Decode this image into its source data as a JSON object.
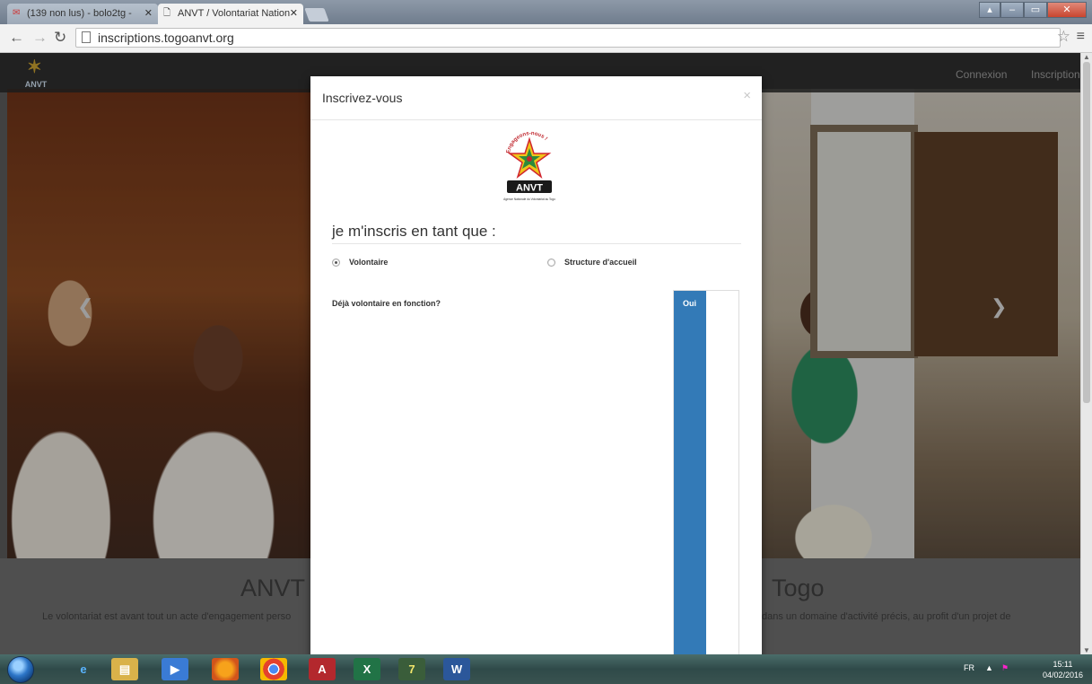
{
  "browser": {
    "tabs": [
      {
        "label": "(139 non lus) - bolo2tg - ",
        "icon": "gmail-icon",
        "active": false
      },
      {
        "label": "ANVT / Volontariat Nation",
        "icon": "page-icon",
        "active": true
      }
    ],
    "address": "inscriptions.togoanvt.org"
  },
  "site": {
    "logo_text": "ANVT",
    "nav": {
      "login": "Connexion",
      "register": "Inscription"
    },
    "caption_title_left": "ANVT",
    "caption_title_right": "Togo",
    "caption_text_left": "Le volontariat est avant tout un acte d'engagement perso",
    "caption_text_right": "dans un domaine d'activité précis, au profit d'un projet de"
  },
  "modal": {
    "title": "Inscrivez-vous",
    "close": "×",
    "logo": {
      "tagline": "Engageons-nous !",
      "name": "ANVT",
      "subtitle": "Agence Nationale du Volontariat au Togo"
    },
    "section_title": "je m'inscris en tant que :",
    "options": [
      {
        "label": "Volontaire",
        "checked": true
      },
      {
        "label": "Structure d'accueil",
        "checked": false
      }
    ],
    "question": "Déjà volontaire en fonction?",
    "toggle_label": "Oui",
    "toggle_color": "#337ab7"
  },
  "taskbar": {
    "apps": [
      "internet-explorer-icon",
      "explorer-icon",
      "media-player-icon",
      "firefox-icon",
      "chrome-icon",
      "access-icon",
      "excel-icon",
      "7zip-icon",
      "word-icon"
    ],
    "language": "FR",
    "time": "15:11",
    "date": "04/02/2016"
  }
}
